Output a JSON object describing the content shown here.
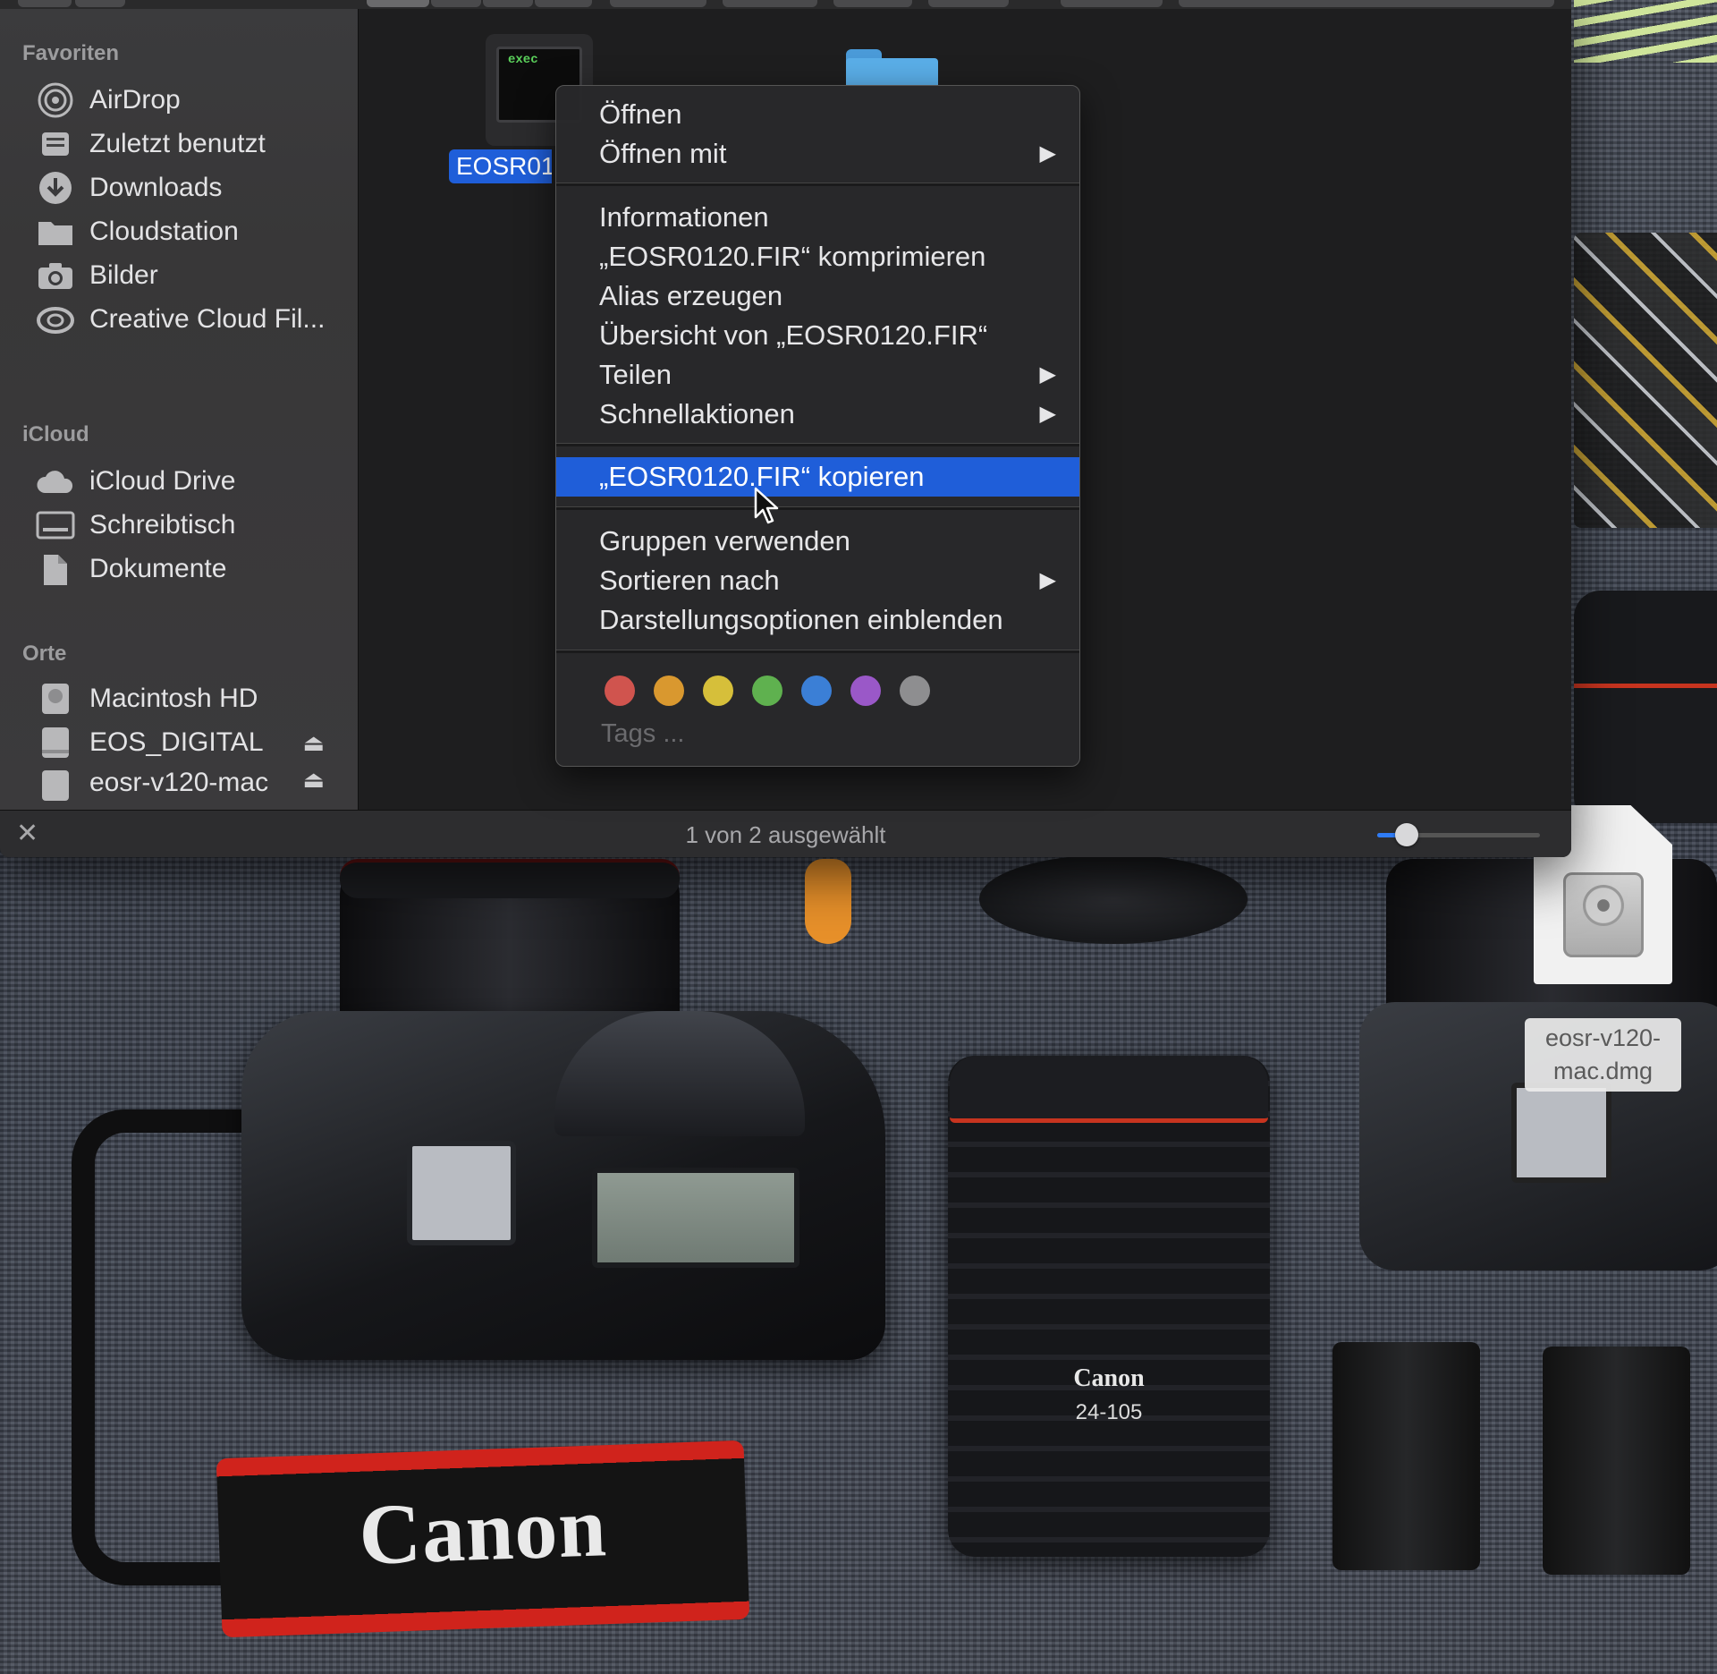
{
  "sidebar": {
    "favorites_heading": "Favoriten",
    "favorites": [
      {
        "label": "AirDrop",
        "icon": "airdrop-icon"
      },
      {
        "label": "Zuletzt benutzt",
        "icon": "recents-icon"
      },
      {
        "label": "Downloads",
        "icon": "downloads-icon"
      },
      {
        "label": "Cloudstation",
        "icon": "folder-icon"
      },
      {
        "label": "Bilder",
        "icon": "camera-icon"
      },
      {
        "label": "Creative Cloud Fil...",
        "icon": "creative-cloud-icon"
      }
    ],
    "icloud_heading": "iCloud",
    "icloud": [
      {
        "label": "iCloud Drive",
        "icon": "cloud-icon"
      },
      {
        "label": "Schreibtisch",
        "icon": "desktop-icon"
      },
      {
        "label": "Dokumente",
        "icon": "document-icon"
      }
    ],
    "locations_heading": "Orte",
    "locations": [
      {
        "label": "Macintosh HD",
        "icon": "hard-drive-icon"
      },
      {
        "label": "EOS_DIGITAL",
        "icon": "external-drive-icon",
        "eject": "⏏"
      },
      {
        "label": "eosr-v120-mac",
        "icon": "external-drive-icon",
        "eject": "⏏"
      }
    ]
  },
  "content": {
    "selected_file_label": "EOSR0120.FIR",
    "exec_badge": "exec"
  },
  "context_menu": {
    "items": [
      {
        "label": "Öffnen"
      },
      {
        "label": "Öffnen mit",
        "submenu": true
      },
      {
        "label": "Informationen"
      },
      {
        "label": "„EOSR0120.FIR“ komprimieren"
      },
      {
        "label": "Alias erzeugen"
      },
      {
        "label": "Übersicht von „EOSR0120.FIR“"
      },
      {
        "label": "Teilen",
        "submenu": true
      },
      {
        "label": "Schnellaktionen",
        "submenu": true
      },
      {
        "label": "„EOSR0120.FIR“ kopieren",
        "highlighted": true
      },
      {
        "label": "Gruppen verwenden"
      },
      {
        "label": "Sortieren nach",
        "submenu": true
      },
      {
        "label": "Darstellungsoptionen einblenden"
      }
    ],
    "submenu_arrow": "▶",
    "tag_colors": [
      "#d0544e",
      "#d9982f",
      "#d6bf3a",
      "#5fb14f",
      "#3b7fd6",
      "#9a58c8",
      "#8e8e90"
    ],
    "tags_label": "Tags ..."
  },
  "statusbar": {
    "status_text": "1 von 2 ausgewählt",
    "close_glyph": "✕",
    "icon_size_slider": 0.18
  },
  "desktop": {
    "dmg_label": "eosr-v120-mac.dmg",
    "strap_text": "Canon",
    "lens_brand": "Canon",
    "lens_model": "24-105"
  },
  "colors": {
    "selection_blue": "#1f5ed9",
    "menu_background": "#28282a"
  }
}
